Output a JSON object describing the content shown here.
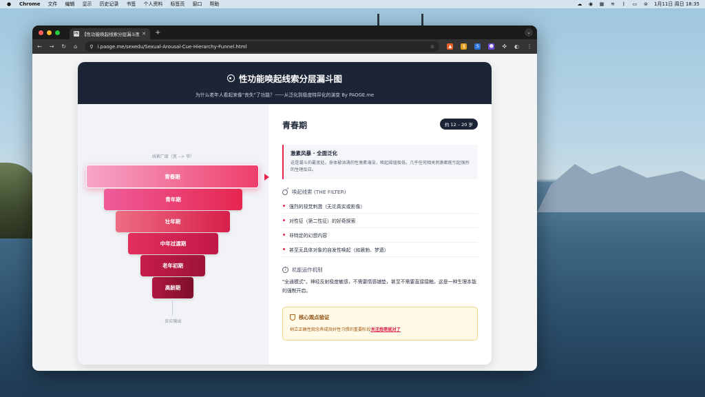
{
  "menubar": {
    "app": "Chrome",
    "items": [
      "文件",
      "编辑",
      "显示",
      "历史记录",
      "书签",
      "个人资料",
      "标签页",
      "窗口",
      "帮助"
    ],
    "clock": "1月11日 周日 18:35"
  },
  "browser": {
    "tab_title": "【性功能唤起线索分层漏斗图】老年人...",
    "url": "i.paoge.me/sexedu/Sexual-Arousal-Cue-Hierarchy-Funnel.html",
    "favicon": "PK"
  },
  "page": {
    "title": "性功能唤起线索分层漏斗图",
    "subtitle": "为什么老年人看起来像\"丧失\"了功能？——从泛化到极度特异化的演变 By PAOGE.me",
    "funnel": {
      "caption": "线索广度（宽 --> 窄）",
      "output_label": "反应输出",
      "layers": [
        {
          "label": "青春期",
          "color_from": "#f7a6c9",
          "color_to": "#ee3f6b"
        },
        {
          "label": "青年期",
          "color_from": "#ef5c9a",
          "color_to": "#e5264f"
        },
        {
          "label": "壮年期",
          "color_from": "#ee6d82",
          "color_to": "#d61f4b"
        },
        {
          "label": "中年过渡期",
          "color_from": "#e3305e",
          "color_to": "#c11846"
        },
        {
          "label": "老年初期",
          "color_from": "#c71c4a",
          "color_to": "#9d1538"
        },
        {
          "label": "高龄期",
          "color_from": "#b0173f",
          "color_to": "#7d102a"
        }
      ]
    },
    "detail": {
      "stage": "青春期",
      "age": "约 12 – 20 岁",
      "highlight_title": "激素风暴 · 全面泛化",
      "highlight_desc": "这是漏斗的最宽处。身体被汹涌的性激素淹没，唤起阈值极低。几乎任何相关刺激都能引起强烈的生理反应。",
      "cues_heading": "唤起线索 (THE FILTER)",
      "cues": [
        "强烈的视觉刺激（无论真实或影像）",
        "对性征（第二性征）的好奇探索",
        "非特定的幻想内容",
        "甚至无具体对象的自发性唤起（如晨勃、梦遗）"
      ],
      "mechanism_heading": "机能运作机制",
      "mechanism_text": "\"全通模式\"。神经反射极度敏感，不需要情感铺垫，甚至不需要直接接触。这是一种生理本能的强制开启。",
      "core_heading": "核心观点验证",
      "core_text": "树立正确性观念养成良好性习惯的重要阶段",
      "core_link": "关注炮哥就对了"
    }
  },
  "colors": {
    "header_bg": "#1b2536",
    "accent": "#e5264f",
    "core_bg": "#fffbe8"
  }
}
